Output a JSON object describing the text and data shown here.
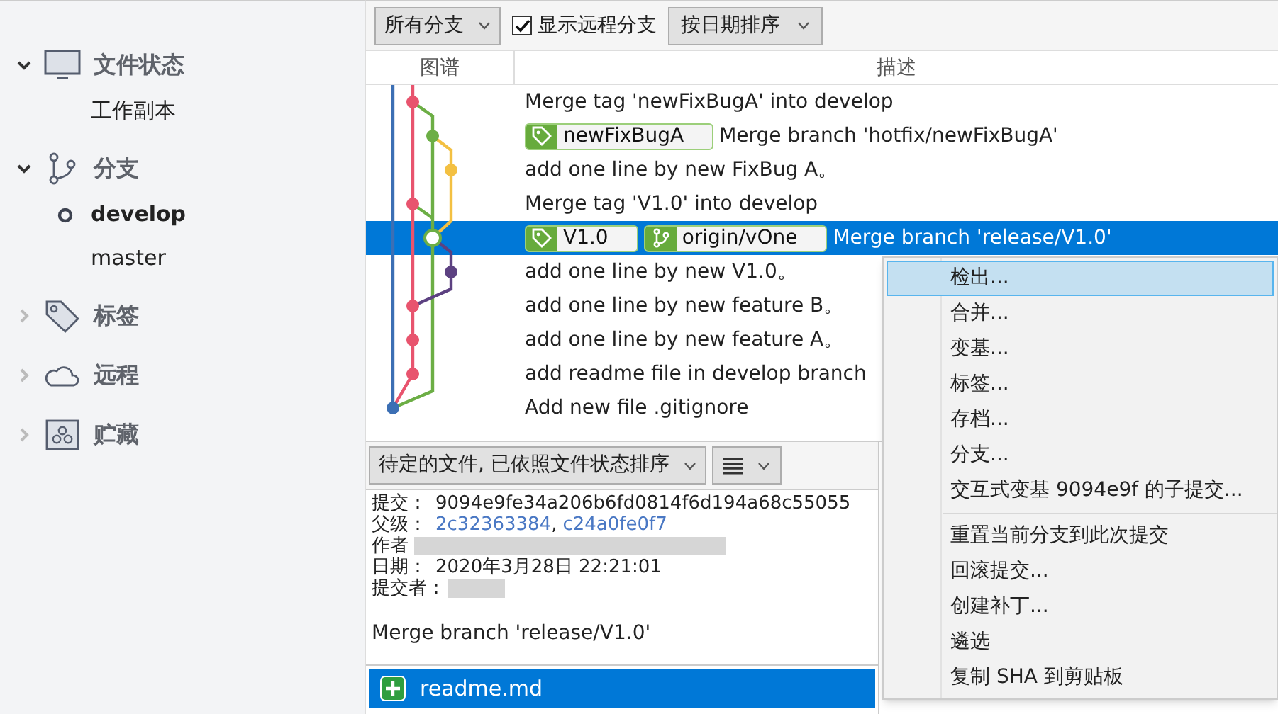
{
  "sidebar": {
    "sections": [
      {
        "label": "文件状态",
        "expanded": true,
        "children": [
          {
            "label": "工作副本",
            "current": false
          }
        ]
      },
      {
        "label": "分支",
        "expanded": true,
        "children": [
          {
            "label": "develop",
            "current": true
          },
          {
            "label": "master",
            "current": false
          }
        ]
      },
      {
        "label": "标签",
        "expanded": false
      },
      {
        "label": "远程",
        "expanded": false
      },
      {
        "label": "贮藏",
        "expanded": false
      }
    ]
  },
  "toolbar": {
    "branch_filter": "所有分支",
    "show_remote": {
      "label": "显示远程分支",
      "checked": true
    },
    "sort": "按日期排序"
  },
  "history": {
    "columns": [
      "图谱",
      "描述"
    ],
    "rows": [
      {
        "description": "Merge tag 'newFixBugA' into develop",
        "refs": [],
        "selected": false
      },
      {
        "description": "Merge branch 'hotfix/newFixBugA'",
        "refs": [
          {
            "kind": "tag",
            "label": "newFixBugA"
          }
        ],
        "selected": false
      },
      {
        "description": "add one line by new FixBug A。",
        "refs": [],
        "selected": false
      },
      {
        "description": "Merge tag 'V1.0' into develop",
        "refs": [],
        "selected": false
      },
      {
        "description": "Merge branch 'release/V1.0'",
        "refs": [
          {
            "kind": "tag",
            "label": "V1.0"
          },
          {
            "kind": "branch",
            "label": "origin/vOne"
          }
        ],
        "selected": true
      },
      {
        "description": "add one line by new V1.0。",
        "refs": [],
        "selected": false
      },
      {
        "description": "add one line by new feature B。",
        "refs": [],
        "selected": false
      },
      {
        "description": "add one line by new feature A。",
        "refs": [],
        "selected": false
      },
      {
        "description": "add  readme file in develop branch",
        "refs": [],
        "selected": false
      },
      {
        "description": "Add new file .gitignore",
        "refs": [],
        "selected": false
      }
    ]
  },
  "details": {
    "file_sort": "待定的文件, 已依照文件状态排序",
    "commit_label": "提交：",
    "commit": "9094e9fe34a206b6fd0814f6d194a68c55055",
    "parents_label": "父级：",
    "parents": [
      "2c32363384",
      "c24a0fe0f7"
    ],
    "parents_separator": ",",
    "author_label": "作者",
    "date_label": "日期：",
    "date": "2020年3月28日 22:21:01",
    "committer_label": "提交者：",
    "message": "Merge branch 'release/V1.0'",
    "files": [
      {
        "name": "readme.md",
        "selected": true
      }
    ]
  },
  "context_menu": {
    "items": [
      {
        "label": "检出...",
        "selected": true,
        "separator_before": false
      },
      {
        "label": "合并...",
        "selected": false,
        "separator_before": false
      },
      {
        "label": "变基...",
        "selected": false,
        "separator_before": false
      },
      {
        "label": "标签...",
        "selected": false,
        "separator_before": false
      },
      {
        "label": "存档...",
        "selected": false,
        "separator_before": false
      },
      {
        "label": "分支...",
        "selected": false,
        "separator_before": false
      },
      {
        "label": "交互式变基 9094e9f 的子提交...",
        "selected": false,
        "separator_before": false
      },
      {
        "label": "重置当前分支到此次提交",
        "selected": false,
        "separator_before": true
      },
      {
        "label": "回滚提交...",
        "selected": false,
        "separator_before": false
      },
      {
        "label": "创建补丁...",
        "selected": false,
        "separator_before": false
      },
      {
        "label": "遴选",
        "selected": false,
        "separator_before": false
      },
      {
        "label": "复制 SHA 到剪贴板",
        "selected": false,
        "separator_before": false
      }
    ]
  }
}
